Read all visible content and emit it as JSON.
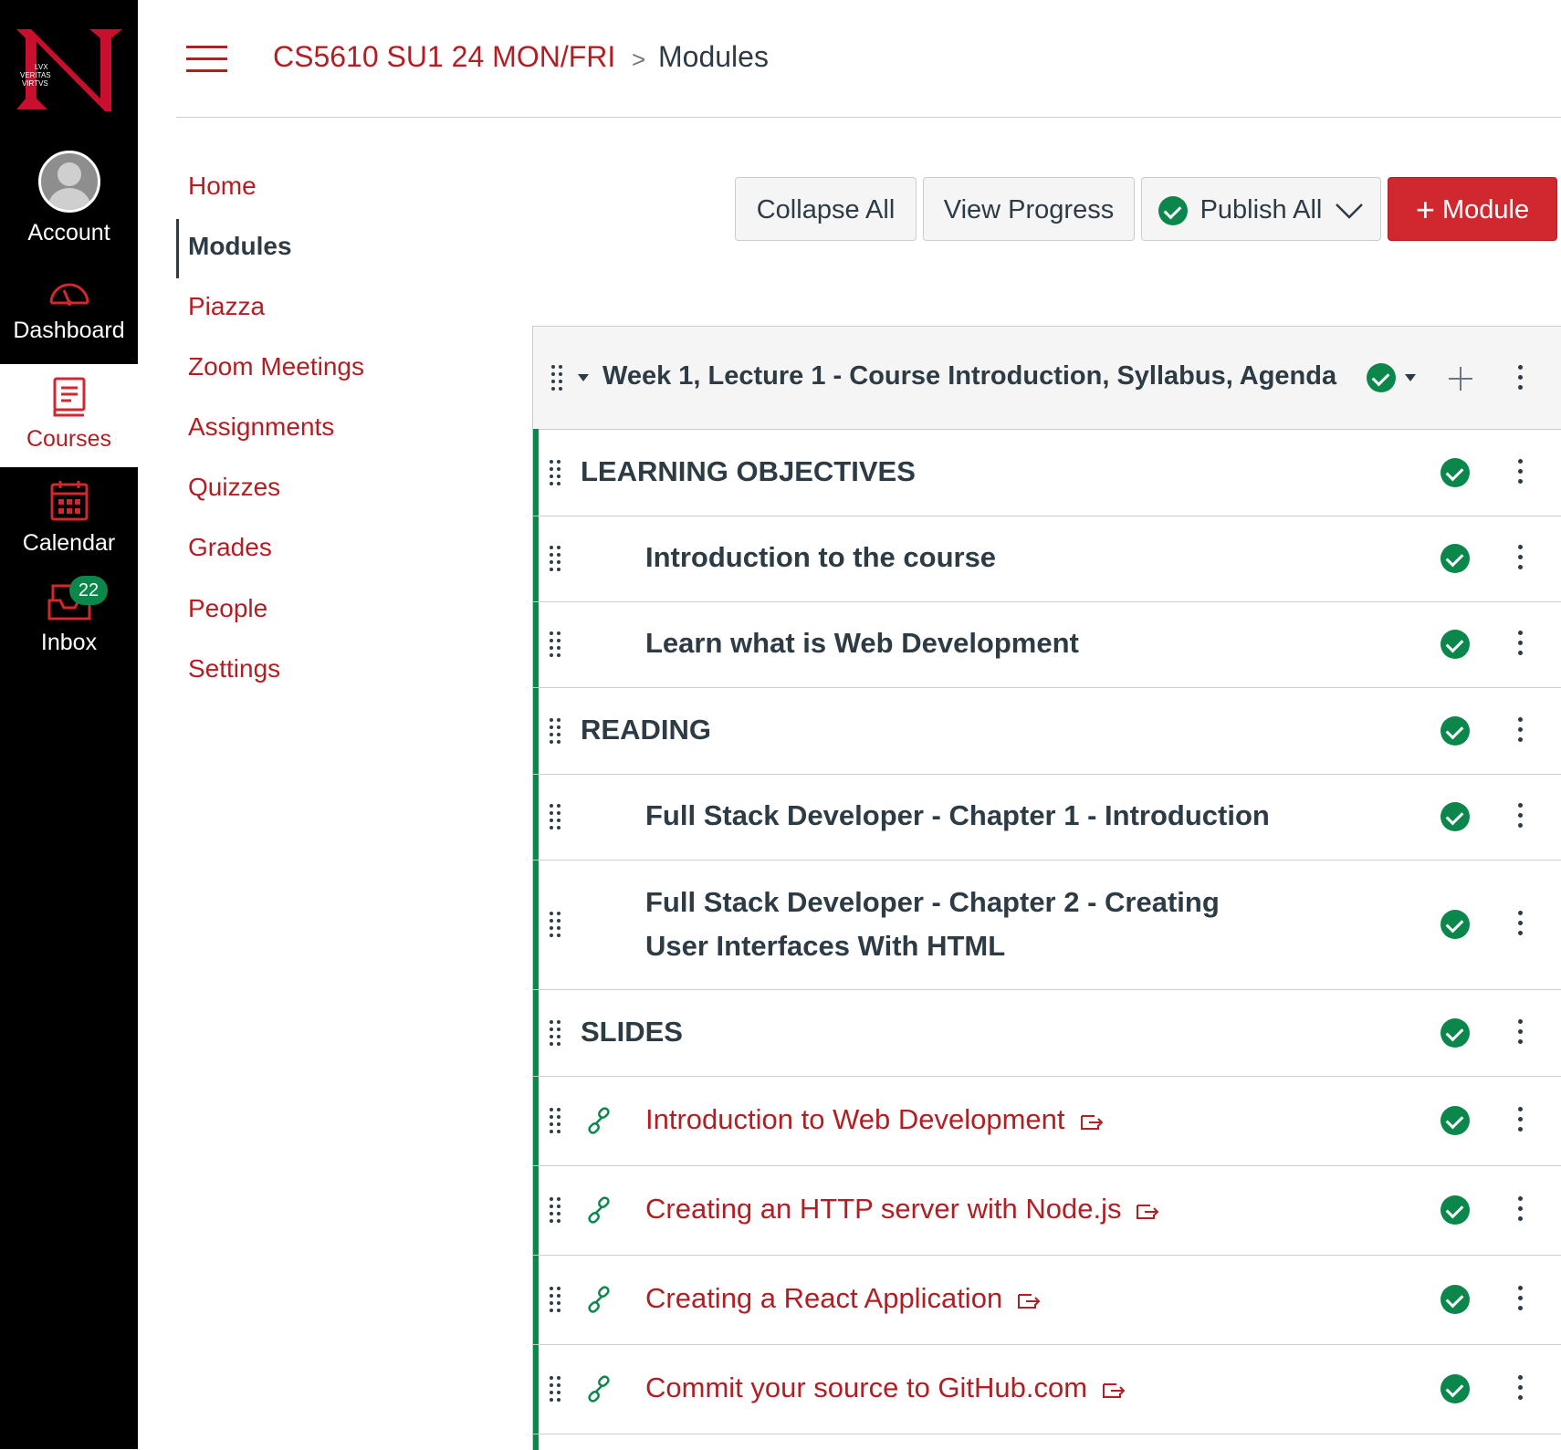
{
  "global_nav": {
    "items": [
      {
        "label": "Account",
        "icon": "user-avatar-icon"
      },
      {
        "label": "Dashboard",
        "icon": "speedometer-icon"
      },
      {
        "label": "Courses",
        "icon": "book-icon"
      },
      {
        "label": "Calendar",
        "icon": "calendar-icon"
      },
      {
        "label": "Inbox",
        "icon": "inbox-icon"
      }
    ],
    "inbox_badge": "22",
    "logo_text": "LVX VERITAS VIRTVS"
  },
  "header": {
    "course": "CS5610 SU1 24 MON/FRI",
    "separator": ">",
    "page": "Modules"
  },
  "course_nav": [
    "Home",
    "Modules",
    "Piazza",
    "Zoom Meetings",
    "Assignments",
    "Quizzes",
    "Grades",
    "People",
    "Settings"
  ],
  "toolbar": {
    "collapse_all": "Collapse All",
    "view_progress": "View Progress",
    "publish_all": "Publish All",
    "add_module": "Module"
  },
  "module": {
    "title": "Week 1, Lecture 1 - Course Introduction, Syllabus, Agenda",
    "items": [
      {
        "type": "header",
        "text": "LEARNING OBJECTIVES"
      },
      {
        "type": "subheader",
        "text": "Introduction to the course"
      },
      {
        "type": "subheader",
        "text": "Learn what is Web Development"
      },
      {
        "type": "header",
        "text": "READING"
      },
      {
        "type": "subheader",
        "text": "Full Stack Developer - Chapter 1 - Introduction"
      },
      {
        "type": "subheader",
        "text": "Full Stack Developer - Chapter 2 - Creating User Interfaces With HTML"
      },
      {
        "type": "header",
        "text": "SLIDES"
      },
      {
        "type": "link",
        "text": "Introduction to Web Development"
      },
      {
        "type": "link",
        "text": "Creating an HTTP server with Node.js"
      },
      {
        "type": "link",
        "text": "Creating a React Application"
      },
      {
        "type": "link",
        "text": "Commit your source to GitHub.com"
      }
    ]
  },
  "colors": {
    "brand": "#b11f24",
    "published": "#0b874b",
    "text": "#2d3b45"
  }
}
